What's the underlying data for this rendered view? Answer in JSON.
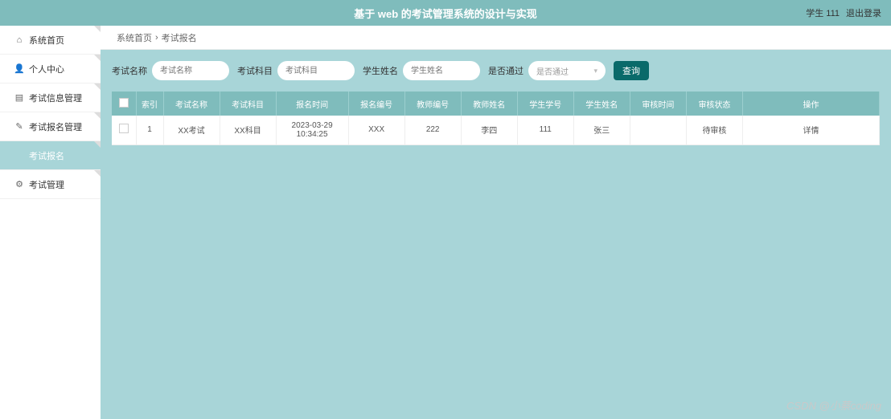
{
  "header": {
    "title": "基于 web 的考试管理系统的设计与实现",
    "user": "学生 111",
    "logout": "退出登录"
  },
  "sidebar": {
    "items": [
      {
        "icon": "home",
        "label": "系统首页"
      },
      {
        "icon": "user",
        "label": "个人中心"
      },
      {
        "icon": "list",
        "label": "考试信息管理"
      },
      {
        "icon": "edit",
        "label": "考试报名管理"
      },
      {
        "icon": "",
        "label": "考试报名"
      },
      {
        "icon": "gear",
        "label": "考试管理"
      }
    ]
  },
  "breadcrumb": {
    "a": "系统首页",
    "sep": "›",
    "b": "考试报名"
  },
  "filters": {
    "name_label": "考试名称",
    "name_ph": "考试名称",
    "subject_label": "考试科目",
    "subject_ph": "考试科目",
    "student_label": "学生姓名",
    "student_ph": "学生姓名",
    "pass_label": "是否通过",
    "pass_ph": "是否通过",
    "query": "查询"
  },
  "table": {
    "headers": [
      "",
      "索引",
      "考试名称",
      "考试科目",
      "报名时间",
      "报名编号",
      "教师编号",
      "教师姓名",
      "学生学号",
      "学生姓名",
      "审核时间",
      "审核状态",
      "操作"
    ],
    "rows": [
      {
        "idx": "1",
        "exam": "XX考试",
        "subject": "XX科目",
        "time": "2023-03-29 10:34:25",
        "code": "XXX",
        "tno": "222",
        "tname": "李四",
        "sno": "111",
        "sname": "张三",
        "atime": "",
        "status": "待审核",
        "op": "详情"
      }
    ]
  },
  "watermark": "CSDN @小蔡coding"
}
